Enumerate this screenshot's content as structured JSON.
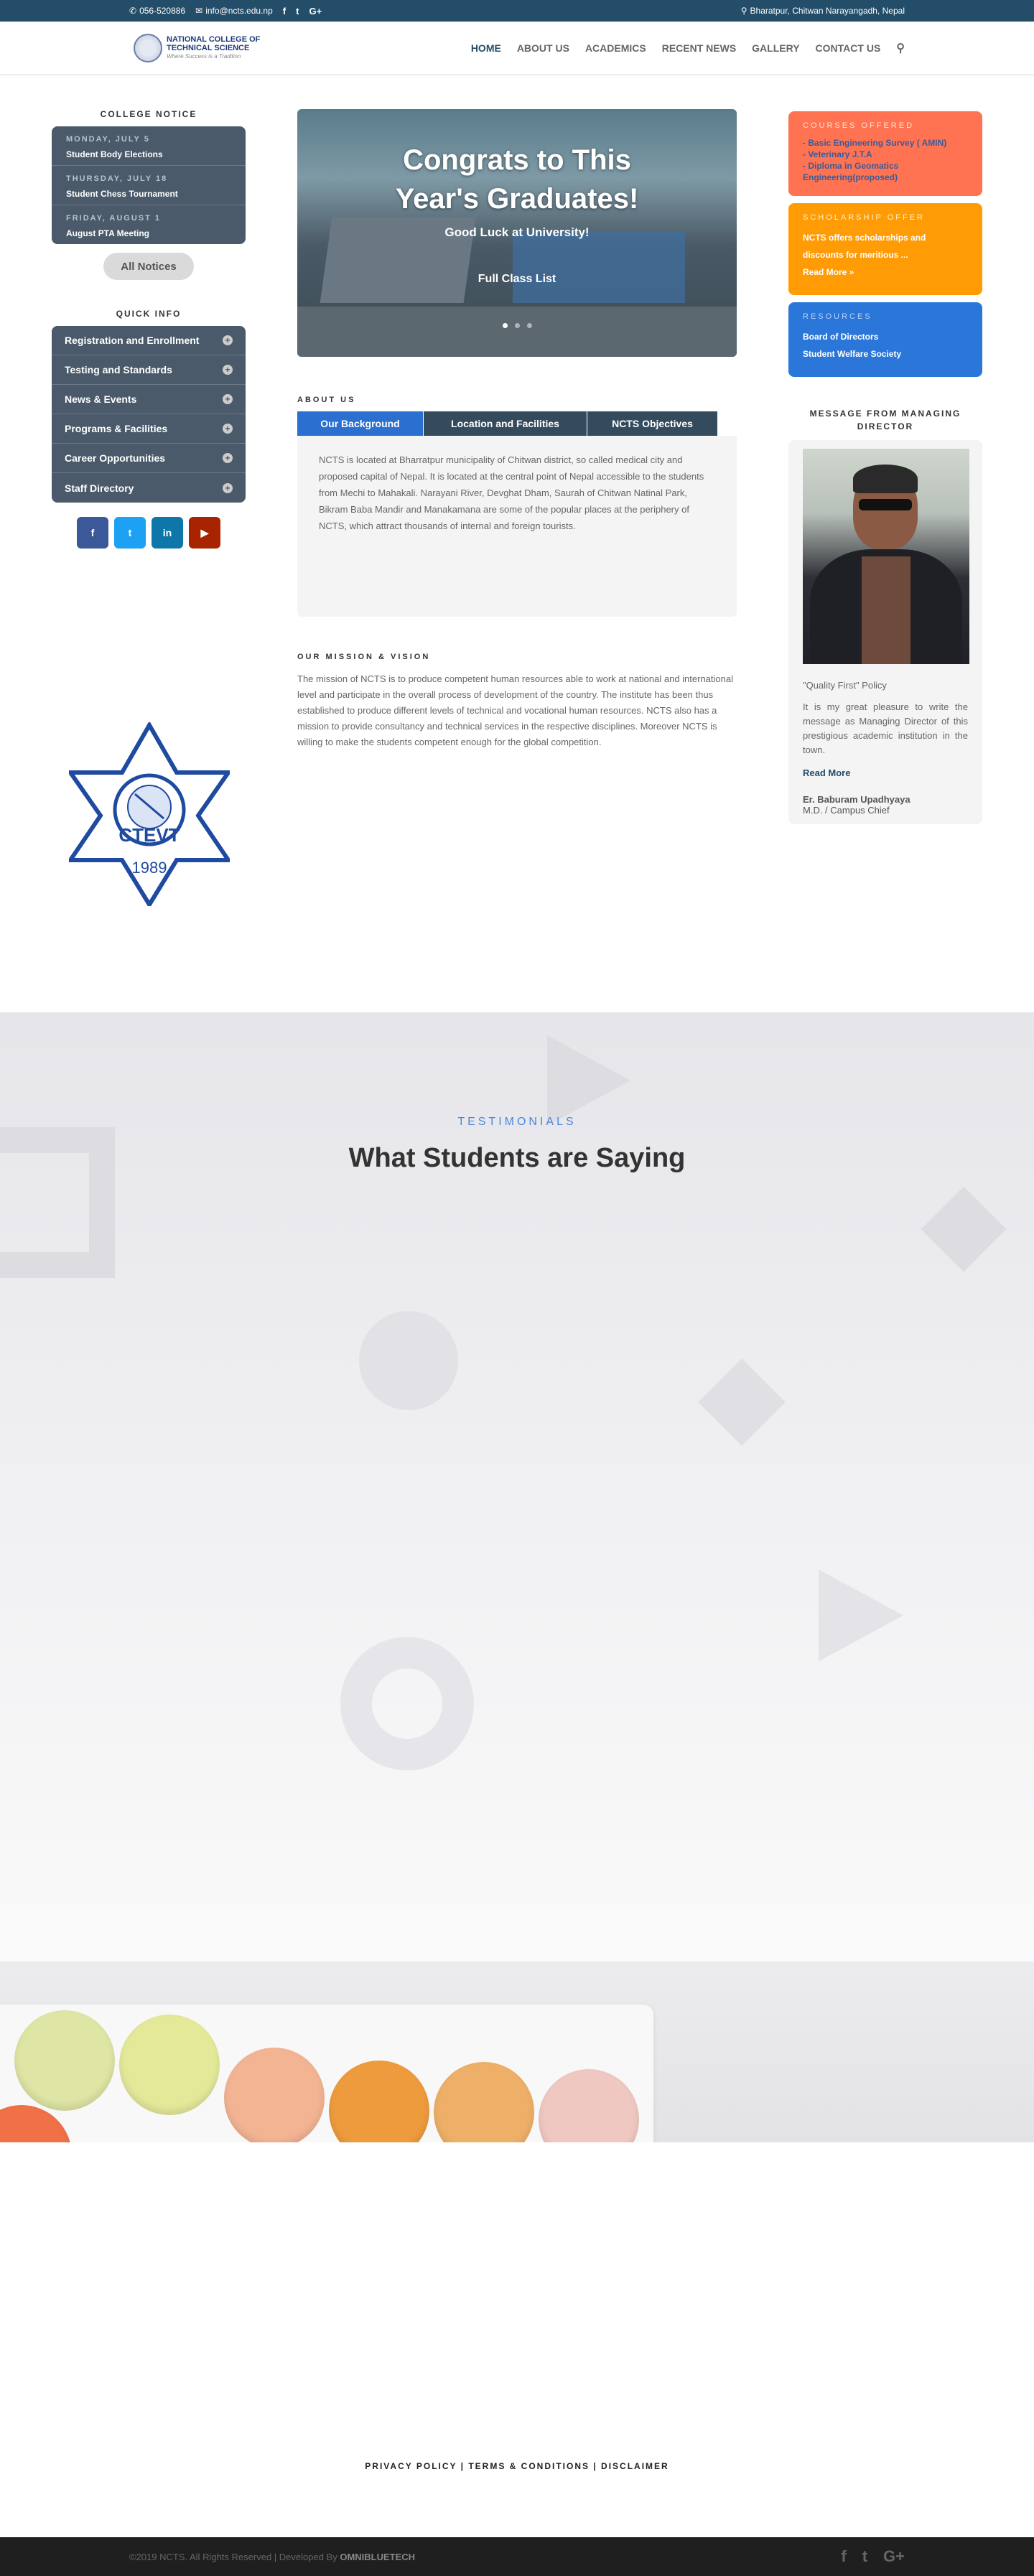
{
  "topbar": {
    "phone": "056-520886",
    "email": "info@ncts.edu.np",
    "social": [
      "f",
      "t",
      "G+"
    ],
    "location": "Bharatpur, Chitwan Narayangadh, Nepal"
  },
  "header": {
    "logo_line1": "NATIONAL COLLEGE OF",
    "logo_line2": "TECHNICAL SCIENCE",
    "logo_tagline": "Where Success is a Tradition",
    "nav": [
      "HOME",
      "ABOUT US",
      "ACADEMICS",
      "RECENT NEWS",
      "GALLERY",
      "CONTACT US"
    ]
  },
  "college_notice": {
    "title": "COLLEGE NOTICE",
    "items": [
      {
        "date": "MONDAY, JULY 5",
        "title": "Student Body Elections"
      },
      {
        "date": "THURSDAY, JULY 18",
        "title": "Student Chess Tournament"
      },
      {
        "date": "FRIDAY, AUGUST 1",
        "title": "August PTA Meeting"
      }
    ],
    "button": "All Notices"
  },
  "quick_info": {
    "title": "QUICK INFO",
    "items": [
      "Registration and Enrollment",
      "Testing and Standards",
      "News & Events",
      "Programs & Facilities",
      "Career Opportunities",
      "Staff Directory"
    ]
  },
  "social_buttons": [
    {
      "label": "f",
      "color": "#3b5998"
    },
    {
      "label": "t",
      "color": "#1da1f2"
    },
    {
      "label": "in",
      "color": "#0e76a8"
    },
    {
      "label": "▶",
      "color": "#a82400"
    }
  ],
  "slider": {
    "heading_line1": "Congrats to This",
    "heading_line2": "Year's Graduates!",
    "sub": "Good Luck at University!",
    "cta": "Full Class List"
  },
  "about": {
    "label": "ABOUT US",
    "tabs": [
      "Our Background",
      "Location and Facilities",
      "NCTS Objectives"
    ],
    "body": "NCTS is located at Bharratpur municipality of Chitwan district, so called medical city and proposed capital of Nepal. It is located at the central point of Nepal accessible to the students from Mechi to Mahakali. Narayani River, Devghat Dham, Saurah of Chitwan Natinal Park, Bikram Baba Mandir and Manakamana are some of the popular places at the periphery of NCTS, which attract thousands of internal and foreign tourists."
  },
  "mission": {
    "label": "OUR MISSION & VISION",
    "body": "The mission of NCTS is to produce competent human resources able to work at national and international level and participate in the overall process of development of the country. The institute has been thus established to produce different levels of technical and vocational human resources. NCTS also has a mission to provide consultancy and technical services in the respective disciplines. Moreover NCTS is willing to make the students competent enough for the global competition."
  },
  "ctevt": {
    "text": "CTEVT",
    "year": "1989"
  },
  "courses": {
    "title": "COURSES OFFERED",
    "items": [
      "- Basic Engineering Survey ( AMIN)",
      "- Veterinary J.T.A",
      "- Diploma in Geomatics Engineering(proposed)"
    ]
  },
  "scholarship": {
    "title": "SCHOLARSHIP OFFER",
    "text": "NCTS offers scholarships and discounts for meritious ...",
    "link": "Read More »"
  },
  "resources": {
    "title": "RESOURCES",
    "items": [
      "Board of Directors",
      "Student Welfare Society"
    ]
  },
  "md": {
    "title": "MESSAGE FROM MANAGING DIRECTOR",
    "policy": "\"Quality First\" Policy",
    "body": "It is my great pleasure to write the message as Managing Director of this prestigious academic institution in the town.",
    "read_more": "Read More",
    "name": "Er. Baburam Upadhyaya",
    "role": "M.D. / Campus Chief"
  },
  "testimonials": {
    "label": "TESTIMONIALS",
    "heading": "What Students are Saying"
  },
  "footer": {
    "links": "PRIVACY POLICY | TERMS & CONDITIONS | DISCLAIMER",
    "copyright_prefix": "©2019 NCTS. All Rights Reserved | Developed By",
    "developer": "OMNIBLUETECH",
    "social": [
      "f",
      "t",
      "G+"
    ]
  }
}
